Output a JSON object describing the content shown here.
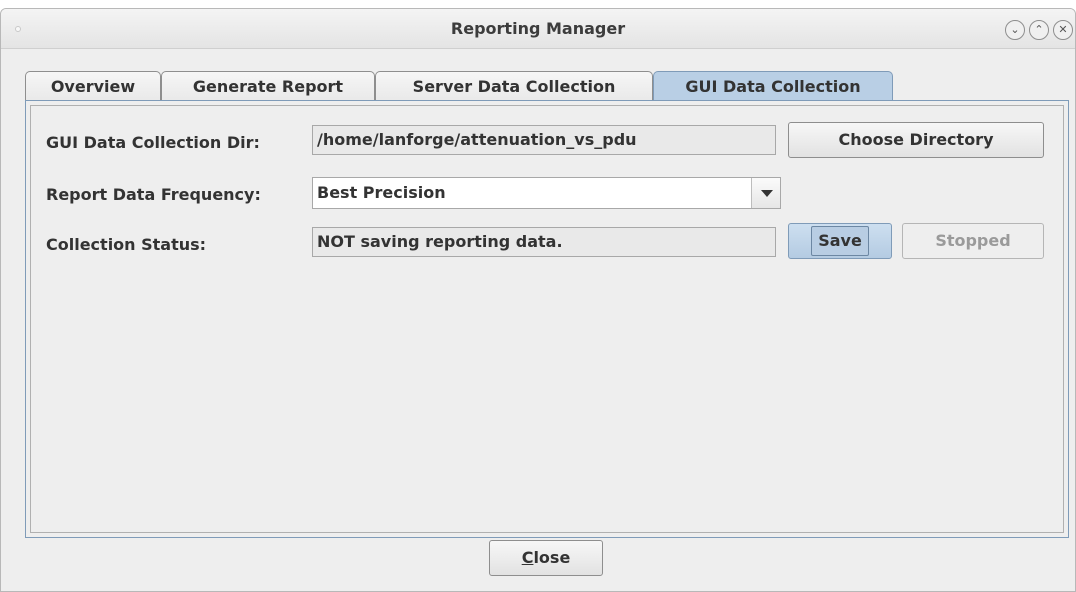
{
  "window": {
    "title": "Reporting Manager",
    "controls": [
      "chevron-down-icon",
      "chevron-up-icon",
      "close-icon"
    ]
  },
  "tabs": [
    {
      "label": "Overview",
      "active": false
    },
    {
      "label": "Generate Report",
      "active": false
    },
    {
      "label": "Server Data Collection",
      "active": false
    },
    {
      "label": "GUI Data Collection",
      "active": true
    }
  ],
  "form": {
    "dir_label": "GUI Data Collection Dir:",
    "dir_value": "/home/lanforge/attenuation_vs_pdu",
    "choose_dir_button": "Choose Directory",
    "frequency_label": "Report Data Frequency:",
    "frequency_value": "Best Precision",
    "status_label": "Collection Status:",
    "status_value": "NOT saving reporting data.",
    "save_button": "Save",
    "stopped_button": "Stopped"
  },
  "footer": {
    "close_mnemonic": "C",
    "close_rest": "lose"
  },
  "colors": {
    "active_tab": "#b9cfe5",
    "accent_border": "#7f9bb8",
    "window_bg": "#eeeeee"
  }
}
